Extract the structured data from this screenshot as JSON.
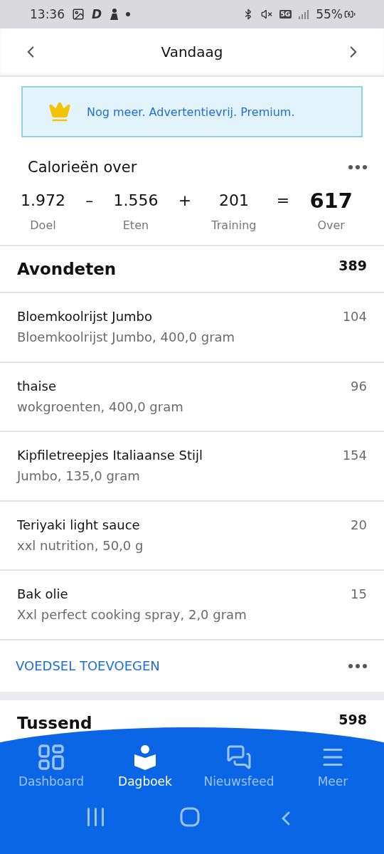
{
  "status_bar": {
    "time": "13:36",
    "app_letter": "D",
    "network": "5G",
    "battery": "55%"
  },
  "header": {
    "title": "Vandaag"
  },
  "promo": {
    "text": "Nog meer. Advertentievrij. Premium."
  },
  "calories": {
    "title": "Calorieën over",
    "terms": [
      {
        "value": "1.972",
        "label": "Doel",
        "kind": "term"
      },
      {
        "value": "–",
        "kind": "operator"
      },
      {
        "value": "1.556",
        "label": "Eten",
        "kind": "term"
      },
      {
        "value": "+",
        "kind": "operator"
      },
      {
        "value": "201",
        "label": "Training",
        "kind": "term"
      },
      {
        "value": "=",
        "kind": "operator"
      },
      {
        "value": "617",
        "label": "Over",
        "kind": "result"
      }
    ]
  },
  "meal": {
    "title": "Avondeten",
    "total": "389",
    "items": [
      {
        "name": "Bloemkoolrijst Jumbo",
        "detail": "Bloemkoolrijst Jumbo, 400,0 gram",
        "calories": "104"
      },
      {
        "name": "thaise",
        "detail": "wokgroenten, 400,0 gram",
        "calories": "96"
      },
      {
        "name": "Kipfiletreepjes Italiaanse Stijl",
        "detail": "Jumbo, 135,0 gram",
        "calories": "154"
      },
      {
        "name": "Teriyaki light sauce",
        "detail": "xxl nutrition, 50,0 g",
        "calories": "20"
      },
      {
        "name": "Bak olie",
        "detail": "Xxl perfect cooking spray, 2,0 gram",
        "calories": "15"
      }
    ],
    "add_label": "VOEDSEL TOEVOEGEN"
  },
  "next_meal": {
    "title": "Tussend",
    "total": "598"
  },
  "tabs": [
    {
      "label": "Dashboard",
      "kind": "dashboard",
      "selected": false
    },
    {
      "label": "Dagboek",
      "kind": "diary",
      "selected": true
    },
    {
      "label": "Nieuwsfeed",
      "kind": "newsfeed",
      "selected": false
    },
    {
      "label": "Meer",
      "kind": "more",
      "selected": false
    }
  ]
}
